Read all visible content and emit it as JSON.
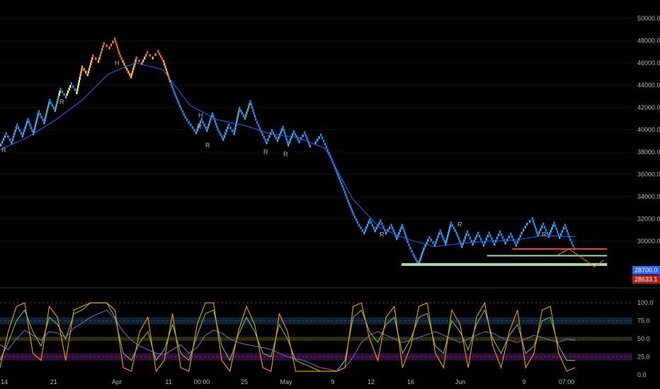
{
  "chart_data": [
    {
      "type": "renko",
      "price_axis": {
        "ylim": [
          26000,
          51000
        ],
        "ticks": [
          "50000.0",
          "48000.0",
          "46000.0",
          "44000.0",
          "42000.0",
          "40000.0",
          "38000.0",
          "36000.0",
          "34000.0",
          "32000.0",
          "30000.0"
        ]
      },
      "time_axis": [
        "14",
        "21",
        "Apr",
        "11",
        "00:00",
        "25",
        "May",
        "9",
        "12",
        "16",
        "Jun",
        "9",
        "07:00"
      ],
      "price_labels": [
        {
          "text": "28700.0",
          "value": 28700,
          "bg": "#2962ff",
          "fg": "#ffffff"
        },
        {
          "text": "28633.1",
          "value": 28633.1,
          "bg": "#b71c1c",
          "fg": "#ffffff"
        }
      ],
      "markers": [
        "R",
        "R",
        "H",
        "R",
        "H",
        "R",
        "R",
        "R",
        "R",
        "R",
        "R"
      ],
      "brick_path": [
        [
          0,
          38500
        ],
        [
          4,
          39500
        ],
        [
          8,
          38700
        ],
        [
          12,
          40300
        ],
        [
          16,
          39300
        ],
        [
          20,
          40800
        ],
        [
          24,
          39500
        ],
        [
          28,
          41500
        ],
        [
          32,
          40500
        ],
        [
          36,
          42500
        ],
        [
          40,
          41600
        ],
        [
          44,
          43500
        ],
        [
          48,
          42800
        ],
        [
          52,
          44000
        ],
        [
          56,
          43200
        ],
        [
          60,
          45500
        ],
        [
          64,
          44800
        ],
        [
          68,
          46500
        ],
        [
          72,
          46000
        ],
        [
          76,
          47600
        ],
        [
          80,
          47200
        ],
        [
          84,
          48000
        ],
        [
          88,
          46500
        ],
        [
          92,
          45500
        ],
        [
          96,
          44600
        ],
        [
          100,
          46300
        ],
        [
          104,
          45800
        ],
        [
          108,
          46800
        ],
        [
          112,
          46300
        ],
        [
          116,
          46900
        ],
        [
          120,
          46000
        ],
        [
          124,
          44500
        ],
        [
          128,
          43200
        ],
        [
          132,
          42000
        ],
        [
          136,
          41000
        ],
        [
          140,
          40300
        ],
        [
          144,
          39600
        ],
        [
          148,
          40800
        ],
        [
          152,
          39800
        ],
        [
          156,
          41300
        ],
        [
          160,
          39900
        ],
        [
          164,
          39000
        ],
        [
          168,
          40300
        ],
        [
          172,
          39500
        ],
        [
          176,
          41800
        ],
        [
          180,
          40900
        ],
        [
          184,
          42400
        ],
        [
          188,
          40800
        ],
        [
          192,
          39700
        ],
        [
          196,
          38700
        ],
        [
          200,
          39800
        ],
        [
          204,
          38900
        ],
        [
          208,
          40100
        ],
        [
          212,
          38500
        ],
        [
          216,
          39700
        ],
        [
          220,
          38800
        ],
        [
          224,
          39600
        ],
        [
          228,
          38400
        ],
        [
          232,
          38700
        ],
        [
          236,
          39400
        ],
        [
          240,
          38300
        ],
        [
          244,
          37200
        ],
        [
          248,
          36000
        ],
        [
          252,
          34800
        ],
        [
          256,
          33500
        ],
        [
          260,
          32300
        ],
        [
          264,
          31300
        ],
        [
          268,
          30600
        ],
        [
          272,
          31800
        ],
        [
          276,
          30800
        ],
        [
          280,
          31700
        ],
        [
          284,
          30600
        ],
        [
          288,
          31300
        ],
        [
          292,
          30100
        ],
        [
          296,
          31300
        ],
        [
          300,
          29800
        ],
        [
          304,
          28700
        ],
        [
          308,
          27800
        ],
        [
          312,
          29200
        ],
        [
          316,
          30200
        ],
        [
          320,
          29500
        ],
        [
          324,
          30800
        ],
        [
          328,
          29600
        ],
        [
          332,
          31500
        ],
        [
          336,
          30600
        ],
        [
          340,
          29400
        ],
        [
          344,
          30700
        ],
        [
          348,
          29600
        ],
        [
          352,
          30600
        ],
        [
          356,
          29500
        ],
        [
          360,
          30600
        ],
        [
          364,
          29600
        ],
        [
          368,
          30700
        ],
        [
          372,
          29700
        ],
        [
          376,
          30500
        ],
        [
          380,
          29500
        ],
        [
          384,
          30600
        ],
        [
          388,
          31400
        ],
        [
          392,
          31900
        ],
        [
          396,
          30400
        ],
        [
          400,
          31400
        ],
        [
          404,
          30300
        ],
        [
          408,
          31500
        ],
        [
          412,
          30200
        ],
        [
          416,
          31300
        ],
        [
          420,
          30000
        ],
        [
          424,
          28900
        ]
      ],
      "moving_average": [
        [
          0,
          38200
        ],
        [
          20,
          39300
        ],
        [
          40,
          40800
        ],
        [
          60,
          42600
        ],
        [
          80,
          45000
        ],
        [
          100,
          46000
        ],
        [
          120,
          45400
        ],
        [
          140,
          42200
        ],
        [
          160,
          40900
        ],
        [
          180,
          40400
        ],
        [
          200,
          39600
        ],
        [
          220,
          39300
        ],
        [
          240,
          38300
        ],
        [
          260,
          33800
        ],
        [
          280,
          31200
        ],
        [
          300,
          30200
        ],
        [
          320,
          29500
        ],
        [
          340,
          29800
        ],
        [
          360,
          30000
        ],
        [
          380,
          30100
        ],
        [
          400,
          30500
        ],
        [
          424,
          30400
        ]
      ],
      "levels": [
        {
          "value": 29300,
          "color": "#e53935",
          "from": 0.81,
          "to": 0.96
        },
        {
          "value": 28700,
          "color": "#a5d6a7",
          "from": 0.77,
          "to": 0.96
        },
        {
          "value": 27900,
          "color": "#a5d6a7",
          "from": 0.635,
          "to": 0.96
        }
      ]
    },
    {
      "type": "line",
      "ylim": [
        0,
        110
      ],
      "ticks": [
        "100.0",
        "75.0",
        "50.0",
        "25.0",
        "0.0"
      ],
      "bands": [
        {
          "from": 70,
          "to": 80,
          "color": "#1e3a5f"
        },
        {
          "from": 47,
          "to": 53,
          "color": "#4a4a10"
        },
        {
          "from": 20,
          "to": 30,
          "color": "#5a1a6a"
        }
      ],
      "series": [
        {
          "color": "#7e57c2",
          "values": [
            42,
            35,
            50,
            62,
            55,
            48,
            60,
            58,
            52,
            65,
            72,
            80,
            85,
            90,
            78,
            60,
            48,
            40,
            35,
            30,
            28,
            35,
            42,
            30,
            38,
            55,
            62,
            58,
            50,
            45,
            42,
            40,
            38,
            35,
            30,
            25,
            22,
            20,
            15,
            10,
            8,
            5,
            10,
            25,
            45,
            55,
            60,
            55,
            50,
            45,
            48,
            52,
            56,
            60,
            55,
            50,
            45,
            50,
            55,
            60,
            58,
            52,
            48,
            45,
            50,
            55,
            52,
            48,
            45,
            50,
            48
          ]
        },
        {
          "color": "#66bb6a",
          "values": [
            20,
            45,
            75,
            90,
            60,
            40,
            80,
            70,
            50,
            85,
            90,
            100,
            100,
            100,
            80,
            30,
            20,
            45,
            60,
            20,
            35,
            70,
            30,
            20,
            55,
            85,
            90,
            40,
            20,
            55,
            80,
            60,
            30,
            25,
            70,
            50,
            20,
            15,
            10,
            5,
            5,
            5,
            20,
            80,
            90,
            60,
            45,
            70,
            80,
            30,
            50,
            80,
            85,
            40,
            30,
            75,
            60,
            35,
            70,
            90,
            50,
            30,
            55,
            70,
            30,
            40,
            75,
            80,
            40,
            20,
            20
          ]
        },
        {
          "color": "#ff9800",
          "values": [
            10,
            60,
            95,
            100,
            30,
            20,
            95,
            80,
            20,
            90,
            95,
            100,
            100,
            100,
            90,
            10,
            5,
            60,
            80,
            5,
            20,
            85,
            10,
            5,
            70,
            100,
            100,
            20,
            5,
            60,
            95,
            70,
            10,
            5,
            85,
            60,
            5,
            5,
            5,
            5,
            5,
            5,
            10,
            95,
            100,
            50,
            20,
            80,
            95,
            10,
            40,
            95,
            100,
            30,
            10,
            90,
            70,
            10,
            80,
            100,
            40,
            10,
            60,
            90,
            10,
            30,
            90,
            95,
            30,
            5,
            10
          ]
        }
      ]
    }
  ]
}
